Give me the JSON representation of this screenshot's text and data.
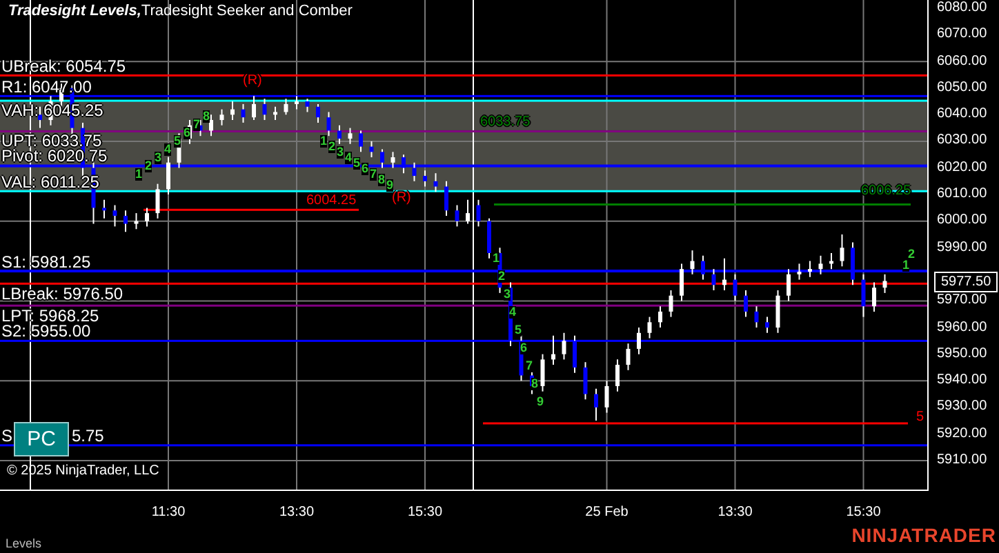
{
  "title": {
    "indicator": "Tradesight Levels,",
    "subtitle": "Tradesight Seeker and Comber"
  },
  "counts": [
    {
      "digits": [
        "1",
        "2",
        "3",
        "4",
        "5",
        "6",
        "7",
        "8"
      ]
    },
    {
      "digits": [
        "1",
        "2",
        "3",
        "4",
        "5",
        "6",
        "7",
        "8",
        "9"
      ]
    },
    {
      "digits": [
        "1",
        "2",
        "3",
        "4",
        "5",
        "6",
        "7",
        "8",
        "9"
      ]
    },
    {
      "digits": [
        "1",
        "2"
      ]
    }
  ],
  "pc_button": "PC",
  "copyright": "© 2025 NinjaTrader, LLC",
  "chart_data": {
    "type": "candlestick",
    "categories": [
      null,
      null,
      null,
      null,
      null,
      null,
      null,
      null,
      null,
      null,
      null,
      null,
      "11:30",
      null,
      null,
      null,
      null,
      null,
      null,
      null,
      null,
      null,
      null,
      null,
      "13:30",
      null,
      null,
      null,
      null,
      null,
      null,
      null,
      null,
      null,
      null,
      null,
      "15:30",
      null,
      null,
      null,
      null,
      null,
      null,
      null,
      null,
      null,
      null,
      null,
      null,
      null,
      null,
      null,
      null,
      "25 Feb",
      null,
      null,
      null,
      null,
      null,
      null,
      null,
      null,
      null,
      null,
      null,
      "13:30",
      null,
      null,
      null,
      null,
      null,
      null,
      null,
      null,
      null,
      null,
      null,
      "15:30",
      null,
      null
    ],
    "ohlc": [
      [
        6040,
        6043,
        6035,
        6038
      ],
      [
        6038,
        6047,
        6036,
        6045
      ],
      [
        6045,
        6052,
        6043,
        6050
      ],
      [
        6050,
        6051,
        6032,
        6035
      ],
      [
        6035,
        6037,
        6017,
        6020
      ],
      [
        6020,
        6022,
        5999,
        6005
      ],
      [
        6005,
        6008,
        6001,
        6004
      ],
      [
        6004,
        6006,
        5998,
        6002
      ],
      [
        6002,
        6004,
        5996,
        5999
      ],
      [
        5999,
        6003,
        5997,
        6000
      ],
      [
        6000,
        6005,
        5998,
        6003
      ],
      [
        6003,
        6014,
        6001,
        6012
      ],
      [
        6012,
        6024,
        6010,
        6022
      ],
      [
        6022,
        6033,
        6020,
        6031
      ],
      [
        6031,
        6038,
        6029,
        6036
      ],
      [
        6036,
        6038,
        6032,
        6034
      ],
      [
        6034,
        6040,
        6032,
        6038
      ],
      [
        6038,
        6042,
        6036,
        6040
      ],
      [
        6040,
        6045,
        6038,
        6042
      ],
      [
        6042,
        6044,
        6037,
        6039
      ],
      [
        6039,
        6047,
        6038,
        6044
      ],
      [
        6044,
        6046,
        6038,
        6040
      ],
      [
        6040,
        6043,
        6038,
        6041
      ],
      [
        6041,
        6046,
        6040,
        6044
      ],
      [
        6044,
        6047,
        6042,
        6045
      ],
      [
        6045,
        6046,
        6041,
        6043
      ],
      [
        6043,
        6044,
        6037,
        6039
      ],
      [
        6039,
        6041,
        6032,
        6034
      ],
      [
        6034,
        6036,
        6029,
        6031
      ],
      [
        6031,
        6035,
        6029,
        6033
      ],
      [
        6033,
        6034,
        6026,
        6028
      ],
      [
        6028,
        6030,
        6024,
        6026
      ],
      [
        6026,
        6027,
        6020,
        6022
      ],
      [
        6022,
        6026,
        6020,
        6024
      ],
      [
        6024,
        6025,
        6018,
        6020
      ],
      [
        6020,
        6022,
        6015,
        6017
      ],
      [
        6017,
        6019,
        6013,
        6015
      ],
      [
        6015,
        6018,
        6011,
        6013
      ],
      [
        6013,
        6015,
        6002,
        6004
      ],
      [
        6004,
        6006,
        5998,
        6000
      ],
      [
        6000,
        6008,
        5999,
        6003
      ],
      [
        6006,
        6008,
        5998,
        6000
      ],
      [
        6000,
        6001,
        5986,
        5988
      ],
      [
        5988,
        5990,
        5973,
        5975
      ],
      [
        5975,
        5977,
        5953,
        5955
      ],
      [
        5955,
        5957,
        5940,
        5942
      ],
      [
        5942,
        5944,
        5935,
        5938
      ],
      [
        5938,
        5950,
        5936,
        5948
      ],
      [
        5948,
        5957,
        5946,
        5950
      ],
      [
        5950,
        5958,
        5948,
        5955
      ],
      [
        5955,
        5957,
        5943,
        5945
      ],
      [
        5945,
        5947,
        5933,
        5935
      ],
      [
        5935,
        5937,
        5925,
        5930
      ],
      [
        5930,
        5940,
        5928,
        5938
      ],
      [
        5938,
        5948,
        5936,
        5946
      ],
      [
        5946,
        5954,
        5944,
        5952
      ],
      [
        5952,
        5960,
        5950,
        5958
      ],
      [
        5958,
        5964,
        5956,
        5962
      ],
      [
        5962,
        5968,
        5960,
        5966
      ],
      [
        5966,
        5974,
        5964,
        5972
      ],
      [
        5972,
        5984,
        5970,
        5982
      ],
      [
        5982,
        5989,
        5980,
        5985
      ],
      [
        5985,
        5987,
        5978,
        5980
      ],
      [
        5980,
        5982,
        5974,
        5976
      ],
      [
        5976,
        5986,
        5974,
        5978
      ],
      [
        5978,
        5980,
        5970,
        5972
      ],
      [
        5972,
        5974,
        5964,
        5966
      ],
      [
        5966,
        5968,
        5960,
        5962
      ],
      [
        5962,
        5964,
        5958,
        5960
      ],
      [
        5960,
        5974,
        5958,
        5972
      ],
      [
        5972,
        5982,
        5970,
        5980
      ],
      [
        5980,
        5984,
        5978,
        5981
      ],
      [
        5981,
        5985,
        5979,
        5982
      ],
      [
        5982,
        5987,
        5980,
        5984
      ],
      [
        5984,
        5988,
        5982,
        5985
      ],
      [
        5985,
        5995,
        5983,
        5990
      ],
      [
        5990,
        5992,
        5976,
        5978
      ],
      [
        5978,
        5980,
        5964,
        5968
      ],
      [
        5968,
        5977,
        5966,
        5975
      ],
      [
        5975,
        5980,
        5973,
        5977.5
      ]
    ],
    "ylim": [
      5898.6,
      6083.1
    ],
    "yticks": [
      {
        "value": 6080,
        "label": "6080.00"
      },
      {
        "value": 6070,
        "label": "6070.00"
      },
      {
        "value": 6060,
        "label": "6060.00"
      },
      {
        "value": 6050,
        "label": "6050.00"
      },
      {
        "value": 6040,
        "label": "6040.00"
      },
      {
        "value": 6030,
        "label": "6030.00"
      },
      {
        "value": 6020,
        "label": "6020.00"
      },
      {
        "value": 6010,
        "label": "6010.00"
      },
      {
        "value": 6000,
        "label": "6000.00"
      },
      {
        "value": 5990,
        "label": "5990.00"
      },
      {
        "value": 5970,
        "label": "5970.00"
      },
      {
        "value": 5960,
        "label": "5960.00"
      },
      {
        "value": 5950,
        "label": "5950.00"
      },
      {
        "value": 5940,
        "label": "5940.00"
      },
      {
        "value": 5930,
        "label": "5930.00"
      },
      {
        "value": 5920,
        "label": "5920.00"
      },
      {
        "value": 5910,
        "label": "5910.00"
      }
    ],
    "grid": true,
    "bands": [
      {
        "axis": "y",
        "from": 6011.25,
        "to": 6045.25,
        "color": "#4a4a44"
      }
    ],
    "ref_lines": [
      {
        "axis": "y",
        "value": 6054.75,
        "label": "UBreak: 6054.75",
        "color": "#ff0000"
      },
      {
        "axis": "y",
        "value": 6047,
        "label": "R1: 6047.00",
        "color": "#0000ff"
      },
      {
        "axis": "y",
        "value": 6045.25,
        "label": "VAH: 6045.25",
        "color": "#00ffff"
      },
      {
        "axis": "y",
        "value": 6033.75,
        "label": "UPT: 6033.75",
        "color": "#800080"
      },
      {
        "axis": "y",
        "value": 6020.75,
        "label": "Pivot: 6020.75",
        "color": "#0000ff"
      },
      {
        "axis": "y",
        "value": 6011.25,
        "label": "VAL: 6011.25",
        "color": "#00ffff"
      },
      {
        "axis": "y",
        "value": 5981.25,
        "label": "S1: 5981.25",
        "color": "#0000ff"
      },
      {
        "axis": "y",
        "value": 5976.5,
        "label": "LBreak: 5976.50",
        "color": "#ff0000"
      },
      {
        "axis": "y",
        "value": 5968.25,
        "label": "LPT: 5968.25",
        "color": "#800080"
      },
      {
        "axis": "y",
        "value": 5955,
        "label": "S2: 5955.00",
        "color": "#0000ff"
      },
      {
        "axis": "y",
        "value": 5915.75,
        "label": "S",
        "color": "#0000ff"
      },
      {
        "axis": "y",
        "value": 6004.25,
        "label": "6004.25",
        "color": "#ff0000"
      },
      {
        "axis": "y",
        "value": 6006.25,
        "label": "6006.25",
        "color": "#008000"
      },
      {
        "axis": "y",
        "value": 5924,
        "color": "#ff0000"
      }
    ],
    "annotations": [
      {
        "text": "(R)"
      },
      {
        "text": "(R)"
      },
      {
        "text": "6033.75"
      },
      {
        "text": "5"
      },
      {
        "text": "5.75"
      }
    ]
  },
  "last_price": "5977.50",
  "footer": {
    "tab": "Levels",
    "logo": "NINJATRADER"
  }
}
